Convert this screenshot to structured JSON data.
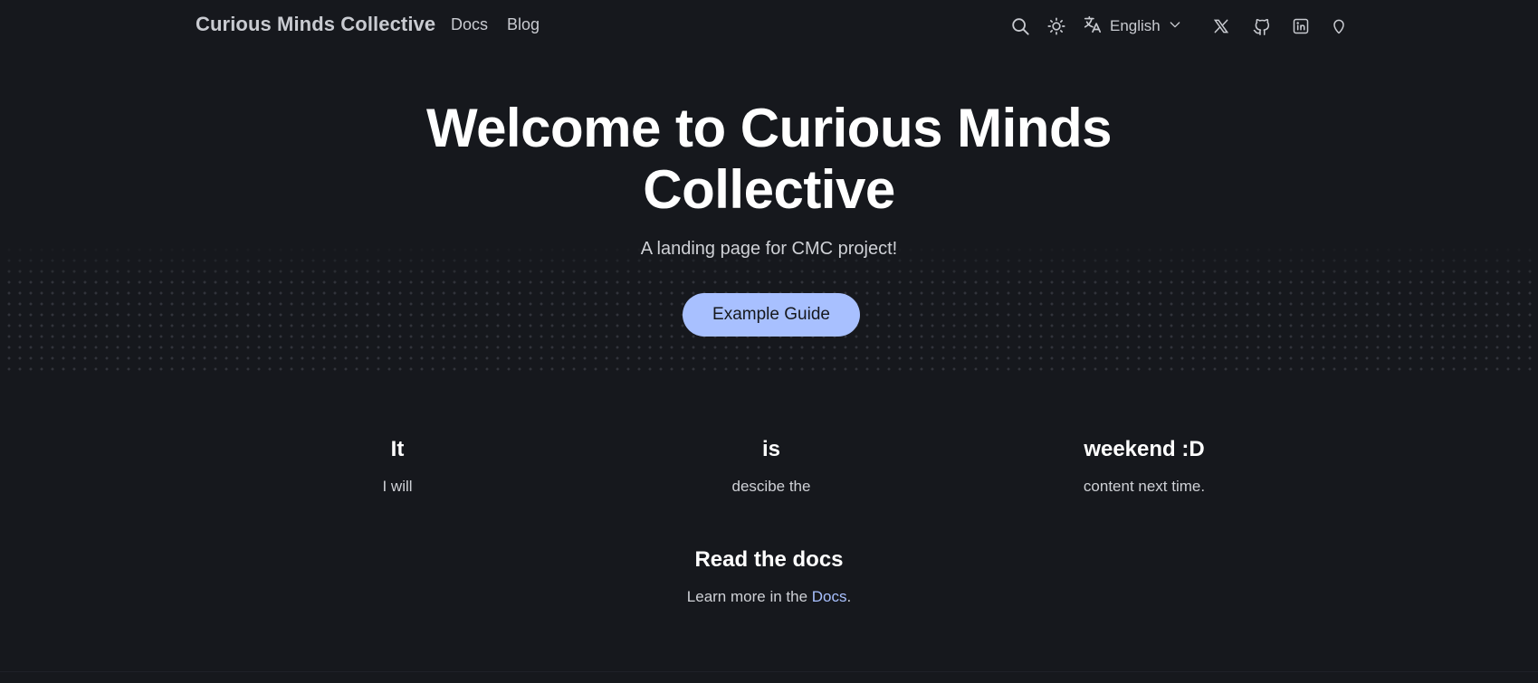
{
  "navbar": {
    "brand": "Curious Minds Collective",
    "links": [
      {
        "label": "Docs"
      },
      {
        "label": "Blog"
      }
    ],
    "language": "English",
    "icons": [
      "search-icon",
      "sun-icon",
      "translate-icon",
      "chevron-down-icon",
      "x-twitter-icon",
      "github-icon",
      "linkedin-icon",
      "pin-icon"
    ]
  },
  "hero": {
    "title_line1": "Welcome to Curious Minds",
    "title_line2": "Collective",
    "subtitle": "A landing page for CMC project!",
    "cta_label": "Example Guide"
  },
  "features": [
    {
      "title": "It",
      "description": "I will"
    },
    {
      "title": "is",
      "description": "descibe the"
    },
    {
      "title": "weekend :D",
      "description": "content next time."
    }
  ],
  "docs_section": {
    "title": "Read the docs",
    "text_before": "Learn more in the ",
    "link_label": "Docs",
    "text_after": "."
  },
  "colors": {
    "background": "#16181d",
    "accent": "#a8c0ff",
    "heading": "#ffffff",
    "text": "#cfd1d6"
  }
}
